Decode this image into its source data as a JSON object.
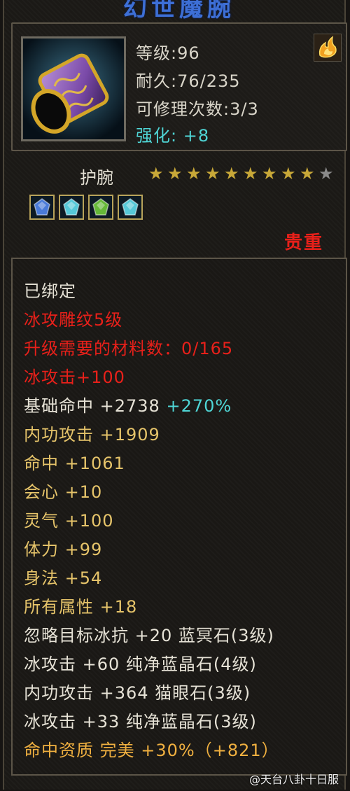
{
  "item": {
    "name": "幻世魔腕",
    "level_text": "等级:96",
    "durability_text": "耐久:76/235",
    "repair_text": "可修理次数:3/3",
    "enhance_text": "强化: +8",
    "type": "护腕",
    "star_rating": {
      "filled": 9,
      "total": 10
    },
    "rarity": "贵重"
  },
  "gems": [
    {
      "icon": "blue-gem-icon",
      "color": "#4a7bd8"
    },
    {
      "icon": "cyan-gem-icon",
      "color": "#56c8d8"
    },
    {
      "icon": "green-gem-icon",
      "color": "#66b838"
    },
    {
      "icon": "cyan-gem-icon",
      "color": "#56c8d8"
    }
  ],
  "attributes": [
    {
      "text": "已绑定",
      "bonus": "",
      "color": "white"
    },
    {
      "text": "冰攻雕纹5级",
      "bonus": "",
      "color": "red"
    },
    {
      "text": "升级需要的材料数：0/165",
      "bonus": "",
      "color": "red"
    },
    {
      "text": "冰攻击+100",
      "bonus": "",
      "color": "red"
    },
    {
      "text": "基础命中 +2738 ",
      "bonus": "+270%",
      "color": "white"
    },
    {
      "text": "内功攻击 +1909",
      "bonus": "",
      "color": "gold"
    },
    {
      "text": "命中 +1061",
      "bonus": "",
      "color": "gold"
    },
    {
      "text": "会心 +10",
      "bonus": "",
      "color": "gold"
    },
    {
      "text": "灵气 +100",
      "bonus": "",
      "color": "gold"
    },
    {
      "text": "体力 +99",
      "bonus": "",
      "color": "gold"
    },
    {
      "text": "身法 +54",
      "bonus": "",
      "color": "gold"
    },
    {
      "text": "所有属性 +18",
      "bonus": "",
      "color": "gold"
    },
    {
      "text": "忽略目标冰抗 +20 蓝冥石(3级)",
      "bonus": "",
      "color": "white"
    },
    {
      "text": "冰攻击 +60 纯净蓝晶石(4级)",
      "bonus": "",
      "color": "white"
    },
    {
      "text": "内功攻击 +364 猫眼石(3级)",
      "bonus": "",
      "color": "white"
    },
    {
      "text": "冰攻击 +33 纯净蓝晶石(3级)",
      "bonus": "",
      "color": "white"
    },
    {
      "text": "命中资质  完美 +30%（+821）",
      "bonus": "",
      "color": "orange"
    }
  ],
  "watermark": "@天台八卦十日服",
  "colors": {
    "title": "#3d6fd6",
    "enhance": "#4fd6d6",
    "rarity": "#e8201a",
    "star_filled": "#c8a838",
    "star_empty": "#8a8a8a"
  }
}
